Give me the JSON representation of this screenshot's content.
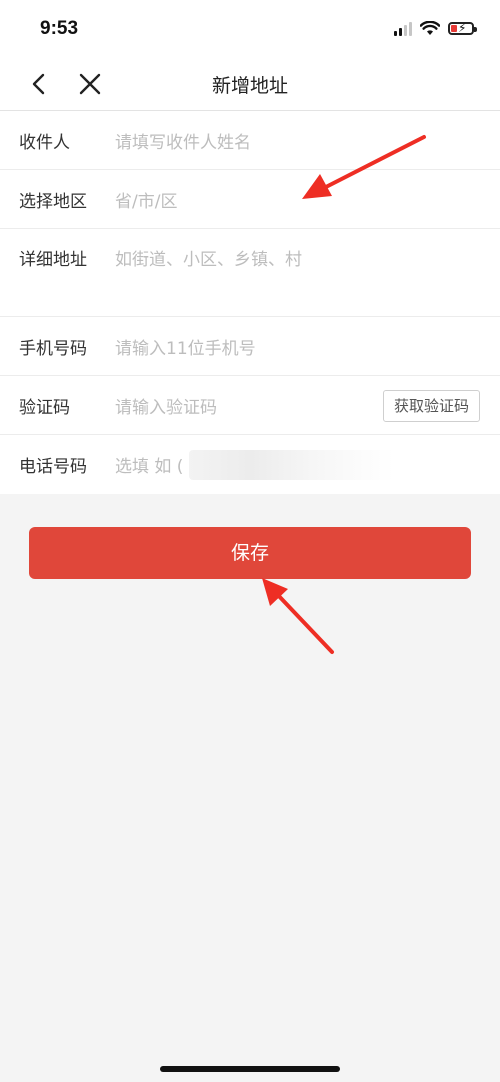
{
  "status": {
    "time": "9:53"
  },
  "nav": {
    "title": "新增地址"
  },
  "form": {
    "recipient": {
      "label": "收件人",
      "placeholder": "请填写收件人姓名"
    },
    "region": {
      "label": "选择地区",
      "placeholder": "省/市/区"
    },
    "address": {
      "label": "详细地址",
      "placeholder": "如街道、小区、乡镇、村"
    },
    "mobile": {
      "label": "手机号码",
      "placeholder": "请输入11位手机号"
    },
    "captcha": {
      "label": "验证码",
      "placeholder": "请输入验证码",
      "button": "获取验证码"
    },
    "phone": {
      "label": "电话号码",
      "placeholder": "选填 如 ("
    }
  },
  "save": {
    "label": "保存"
  },
  "colors": {
    "primary": "#e0473a",
    "arrow": "#ee2e24",
    "placeholder": "#bdbdbd"
  }
}
